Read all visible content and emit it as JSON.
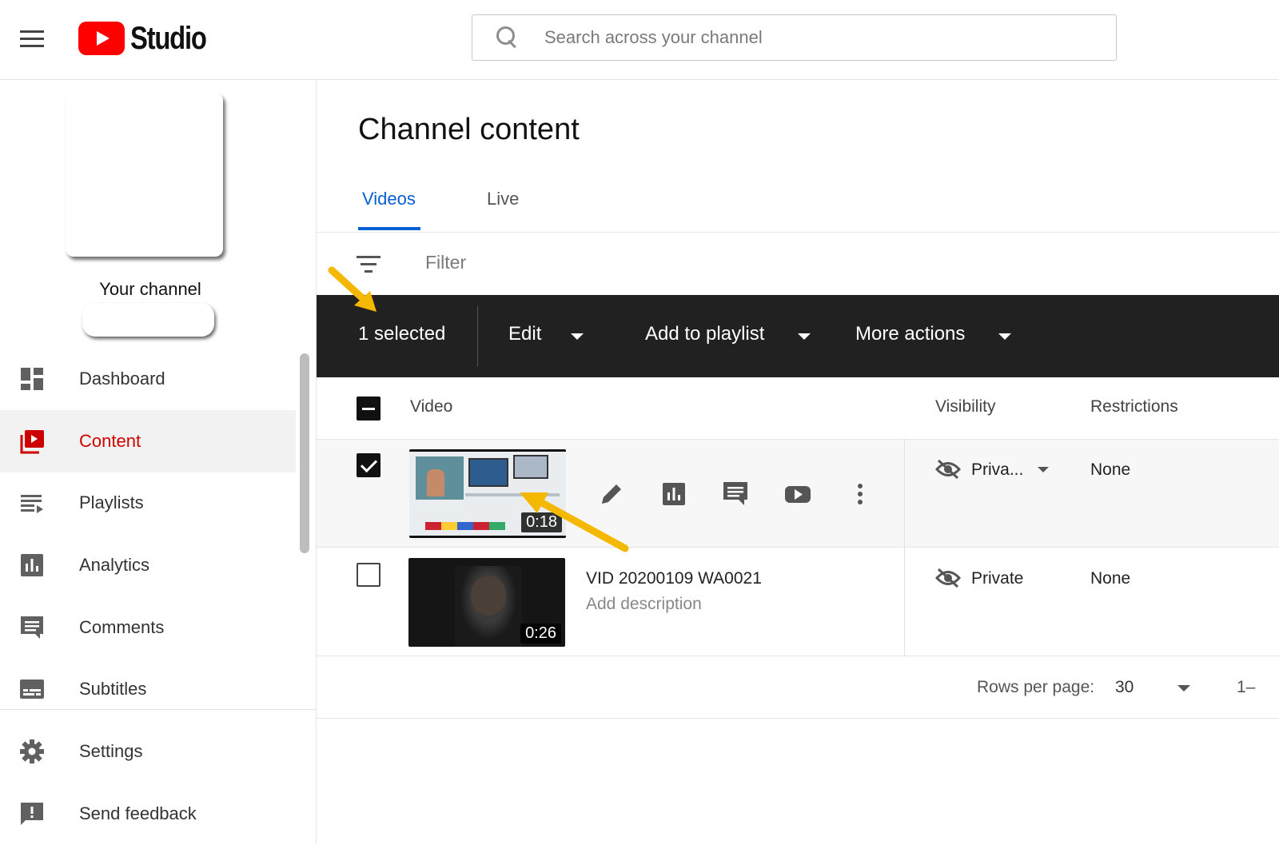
{
  "header": {
    "app_name": "Studio",
    "search_placeholder": "Search across your channel"
  },
  "sidebar": {
    "channel_label": "Your channel",
    "items": [
      {
        "label": "Dashboard",
        "icon": "dashboard-icon"
      },
      {
        "label": "Content",
        "icon": "content-icon",
        "active": true
      },
      {
        "label": "Playlists",
        "icon": "playlists-icon"
      },
      {
        "label": "Analytics",
        "icon": "analytics-icon"
      },
      {
        "label": "Comments",
        "icon": "comments-icon"
      },
      {
        "label": "Subtitles",
        "icon": "subtitles-icon"
      }
    ],
    "bottom_items": [
      {
        "label": "Settings",
        "icon": "gear-icon"
      },
      {
        "label": "Send feedback",
        "icon": "feedback-icon"
      }
    ]
  },
  "main": {
    "title": "Channel content",
    "tabs": [
      {
        "label": "Videos",
        "active": true
      },
      {
        "label": "Live"
      }
    ],
    "filter_placeholder": "Filter",
    "action_bar": {
      "selected": "1 selected",
      "edit": "Edit",
      "add_to_playlist": "Add to playlist",
      "more_actions": "More actions"
    },
    "table": {
      "columns": [
        "Video",
        "Visibility",
        "Restrictions"
      ],
      "rows": [
        {
          "duration": "0:18",
          "visibility": "Priva...",
          "restrictions": "None",
          "selected": true
        },
        {
          "title": "VID 20200109 WA0021",
          "description": "Add description",
          "duration": "0:26",
          "visibility": "Private",
          "restrictions": "None",
          "selected": false
        }
      ]
    },
    "pagination": {
      "rows_per_page_label": "Rows per page:",
      "rows_per_page_value": "30",
      "range": "1–"
    }
  },
  "colors": {
    "brand_red": "#ff0000",
    "active_red": "#cc0000",
    "link_blue": "#065fd4",
    "action_bar_bg": "#212121",
    "annotation_arrow": "#f5b800"
  }
}
